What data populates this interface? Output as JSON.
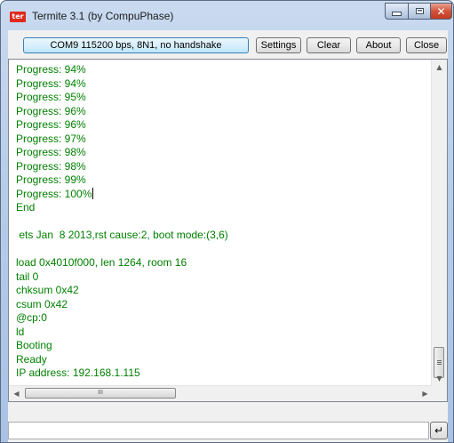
{
  "window": {
    "title": "Termite 3.1 (by CompuPhase)",
    "icon_text": "ter"
  },
  "toolbar": {
    "port_label": "COM9 115200 bps, 8N1, no handshake",
    "settings_label": "Settings",
    "clear_label": "Clear",
    "about_label": "About",
    "close_label": "Close"
  },
  "output": {
    "lines": [
      "Progress: 94%",
      "Progress: 94%",
      "Progress: 95%",
      "Progress: 96%",
      "Progress: 96%",
      "Progress: 97%",
      "Progress: 98%",
      "Progress: 98%",
      "Progress: 99%",
      "Progress: 100%",
      "End",
      "",
      " ets Jan  8 2013,rst cause:2, boot mode:(3,6)",
      "",
      "load 0x4010f000, len 1264, room 16",
      "tail 0",
      "chksum 0x42",
      "csum 0x42",
      "@cp:0",
      "ld",
      "Booting",
      "Ready",
      "IP address: 192.168.1.115"
    ],
    "text_color": "#008000"
  },
  "scrollbars": {
    "up_arrow": "▲",
    "down_arrow": "▼",
    "left_arrow": "◀",
    "right_arrow": "▶",
    "h_thumb_grip": "III"
  },
  "input": {
    "value": "",
    "send_glyph": "↵"
  },
  "colors": {
    "accent": "#3c7fb1",
    "close_button": "#c23a21"
  }
}
